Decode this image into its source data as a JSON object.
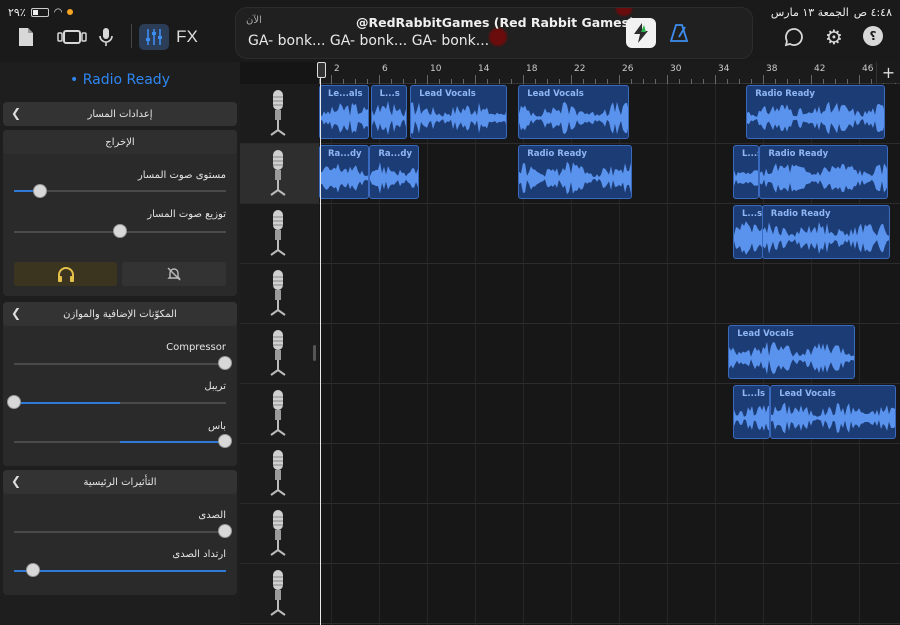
{
  "status_bar": {
    "time": "٤:٤٨ ص",
    "date": "الجمعة ١٣ مارس",
    "battery": "٢٩٪"
  },
  "toolbar": {
    "fx_label": "FX",
    "now_playing": {
      "label": "الآن",
      "title": "@RedRabbitGames (Red Rabbit Games)",
      "subtitle": "GA- bonk... GA- bonk... GA- bonk..."
    }
  },
  "left_panel": {
    "track_name": "Radio Ready",
    "track_settings": {
      "header": "إعدادات المسار"
    },
    "output": {
      "header": "الإخراج",
      "volume_label": "مستوى صوت المسار",
      "volume_value": 0.12,
      "pan_label": "توزيع صوت المسار",
      "pan_value": 0.5
    },
    "plugins": {
      "header": "المكوّنات الإضافية والموازن",
      "compressor_label": "Compressor",
      "compressor_value": 1.0,
      "treble_label": "تريبل",
      "treble_value": 0.0,
      "bass_label": "باس",
      "bass_value": 1.0
    },
    "master_effects": {
      "header": "التأثيرات الرئيسية",
      "echo_label": "الصدى",
      "echo_value": 1.0,
      "reverb_label": "ارتداد الصدى",
      "reverb_value": 0.1
    }
  },
  "ruler": {
    "numbers": [
      "2",
      "6",
      "10",
      "14",
      "18",
      "22",
      "26",
      "30",
      "34",
      "38",
      "42",
      "46"
    ]
  },
  "regions": [
    {
      "track": 0,
      "start": 1,
      "end": 5.2,
      "label": "Le...als"
    },
    {
      "track": 0,
      "start": 5.3,
      "end": 8.3,
      "label": "L...s"
    },
    {
      "track": 0,
      "start": 8.6,
      "end": 16.7,
      "label": "Lead Vocals"
    },
    {
      "track": 0,
      "start": 17.6,
      "end": 26.8,
      "label": "Lead Vocals"
    },
    {
      "track": 0,
      "start": 36.6,
      "end": 48.2,
      "label": "Radio Ready"
    },
    {
      "track": 1,
      "start": 1,
      "end": 5.2,
      "label": "Ra...dy"
    },
    {
      "track": 1,
      "start": 5.2,
      "end": 9.3,
      "label": "Ra...dy"
    },
    {
      "track": 1,
      "start": 17.6,
      "end": 27.1,
      "label": "Radio Ready"
    },
    {
      "track": 1,
      "start": 35.5,
      "end": 37.7,
      "label": "L...s"
    },
    {
      "track": 1,
      "start": 37.7,
      "end": 48.4,
      "label": "Radio Ready"
    },
    {
      "track": 2,
      "start": 35.5,
      "end": 38,
      "label": "L...s"
    },
    {
      "track": 2,
      "start": 37.9,
      "end": 48.6,
      "label": "Radio Ready"
    },
    {
      "track": 4,
      "start": 35.1,
      "end": 45.7,
      "label": "Lead Vocals"
    },
    {
      "track": 5,
      "start": 35.5,
      "end": 38.6,
      "label": "L...ls"
    },
    {
      "track": 5,
      "start": 38.6,
      "end": 49.1,
      "label": "Lead Vocals"
    }
  ],
  "track_count": 9,
  "colors": {
    "accent": "#2f7ad6",
    "region": "#1c3c75",
    "region_wave": "#5a93ee",
    "headphones": "#e3c14b"
  }
}
